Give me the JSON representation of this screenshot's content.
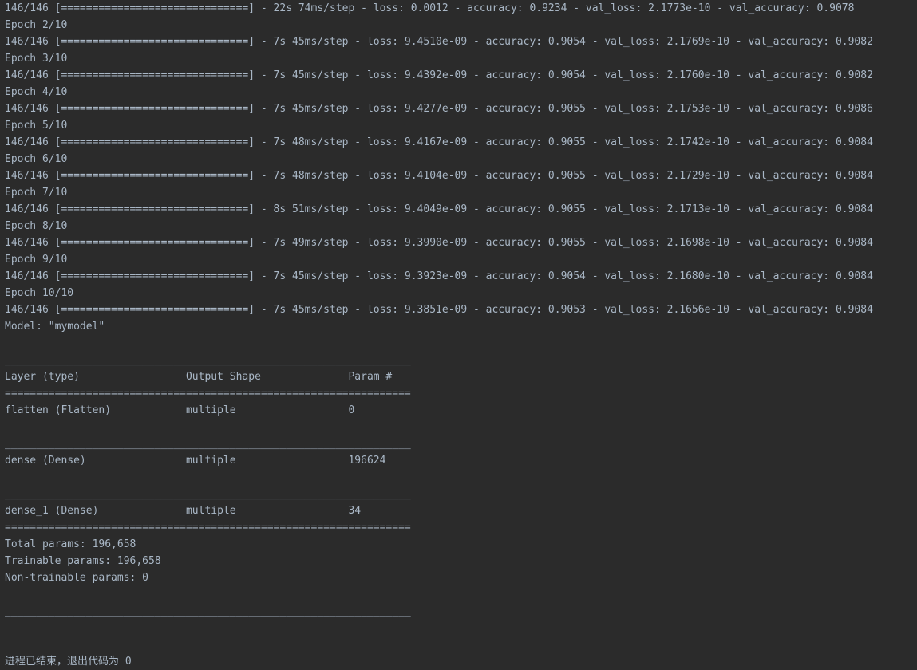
{
  "console": {
    "lines": [
      "146/146 [==============================] - 22s 74ms/step - loss: 0.0012 - accuracy: 0.9234 - val_loss: 2.1773e-10 - val_accuracy: 0.9078",
      "Epoch 2/10",
      "146/146 [==============================] - 7s 45ms/step - loss: 9.4510e-09 - accuracy: 0.9054 - val_loss: 2.1769e-10 - val_accuracy: 0.9082",
      "Epoch 3/10",
      "146/146 [==============================] - 7s 45ms/step - loss: 9.4392e-09 - accuracy: 0.9054 - val_loss: 2.1760e-10 - val_accuracy: 0.9082",
      "Epoch 4/10",
      "146/146 [==============================] - 7s 45ms/step - loss: 9.4277e-09 - accuracy: 0.9055 - val_loss: 2.1753e-10 - val_accuracy: 0.9086",
      "Epoch 5/10",
      "146/146 [==============================] - 7s 48ms/step - loss: 9.4167e-09 - accuracy: 0.9055 - val_loss: 2.1742e-10 - val_accuracy: 0.9084",
      "Epoch 6/10",
      "146/146 [==============================] - 7s 48ms/step - loss: 9.4104e-09 - accuracy: 0.9055 - val_loss: 2.1729e-10 - val_accuracy: 0.9084",
      "Epoch 7/10",
      "146/146 [==============================] - 8s 51ms/step - loss: 9.4049e-09 - accuracy: 0.9055 - val_loss: 2.1713e-10 - val_accuracy: 0.9084",
      "Epoch 8/10",
      "146/146 [==============================] - 7s 49ms/step - loss: 9.3990e-09 - accuracy: 0.9055 - val_loss: 2.1698e-10 - val_accuracy: 0.9084",
      "Epoch 9/10",
      "146/146 [==============================] - 7s 45ms/step - loss: 9.3923e-09 - accuracy: 0.9054 - val_loss: 2.1680e-10 - val_accuracy: 0.9084",
      "Epoch 10/10",
      "146/146 [==============================] - 7s 45ms/step - loss: 9.3851e-09 - accuracy: 0.9053 - val_loss: 2.1656e-10 - val_accuracy: 0.9084",
      "Model: \"mymodel\"",
      "",
      "_________________________________________________________________",
      "Layer (type)                 Output Shape              Param #",
      "=================================================================",
      "flatten (Flatten)            multiple                  0",
      "",
      "_________________________________________________________________",
      "dense (Dense)                multiple                  196624",
      "",
      "_________________________________________________________________",
      "dense_1 (Dense)              multiple                  34",
      "=================================================================",
      "Total params: 196,658",
      "Trainable params: 196,658",
      "Non-trainable params: 0",
      "",
      "_________________________________________________________________",
      "",
      "",
      "进程已结束，退出代码为 0"
    ]
  }
}
